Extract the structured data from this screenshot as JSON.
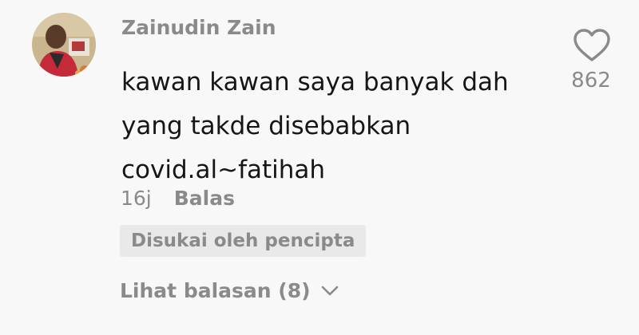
{
  "comment": {
    "author": "Zainudin Zain",
    "text_lines": [
      "kawan kawan saya banyak dah",
      "yang takde disebabkan",
      "covid.al~fatihah"
    ],
    "time": "16j",
    "reply_label": "Balas",
    "creator_badge": "Disukai oleh pencipta",
    "view_replies_label": "Lihat balasan (8)",
    "like_count": "862",
    "like_icon": "heart-outline-icon",
    "view_replies_icon": "chevron-down-icon"
  },
  "colors": {
    "background": "#f8f8f8",
    "primary_text": "#161616",
    "secondary_text": "#8a8a8a",
    "badge_background": "#e9e9e9"
  }
}
